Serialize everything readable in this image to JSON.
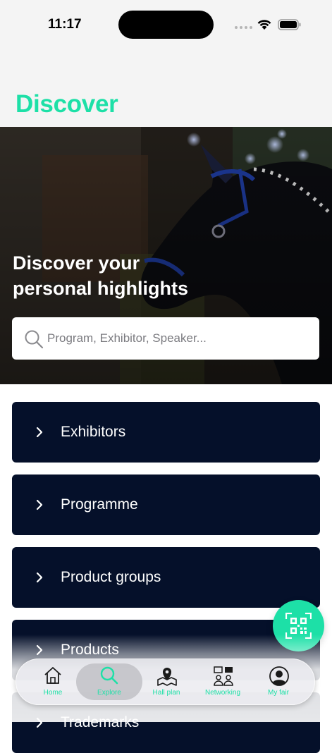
{
  "status": {
    "time": "11:17"
  },
  "header": {
    "title": "Discover"
  },
  "hero": {
    "title": "Discover your personal highlights",
    "search_placeholder": "Program, Exhibitor, Speaker..."
  },
  "menu": [
    {
      "label": "Exhibitors"
    },
    {
      "label": "Programme"
    },
    {
      "label": "Product groups"
    },
    {
      "label": "Products"
    },
    {
      "label": "Trademarks"
    }
  ],
  "tabs": [
    {
      "label": "Home",
      "icon": "house-icon"
    },
    {
      "label": "Explore",
      "icon": "search-icon",
      "active": true
    },
    {
      "label": "Hall plan",
      "icon": "map-pin-icon"
    },
    {
      "label": "Networking",
      "icon": "people-chat-icon"
    },
    {
      "label": "My fair",
      "icon": "user-icon"
    }
  ],
  "colors": {
    "accent": "#1de0a7",
    "card": "#05102a",
    "background": "#f4f4f4"
  }
}
